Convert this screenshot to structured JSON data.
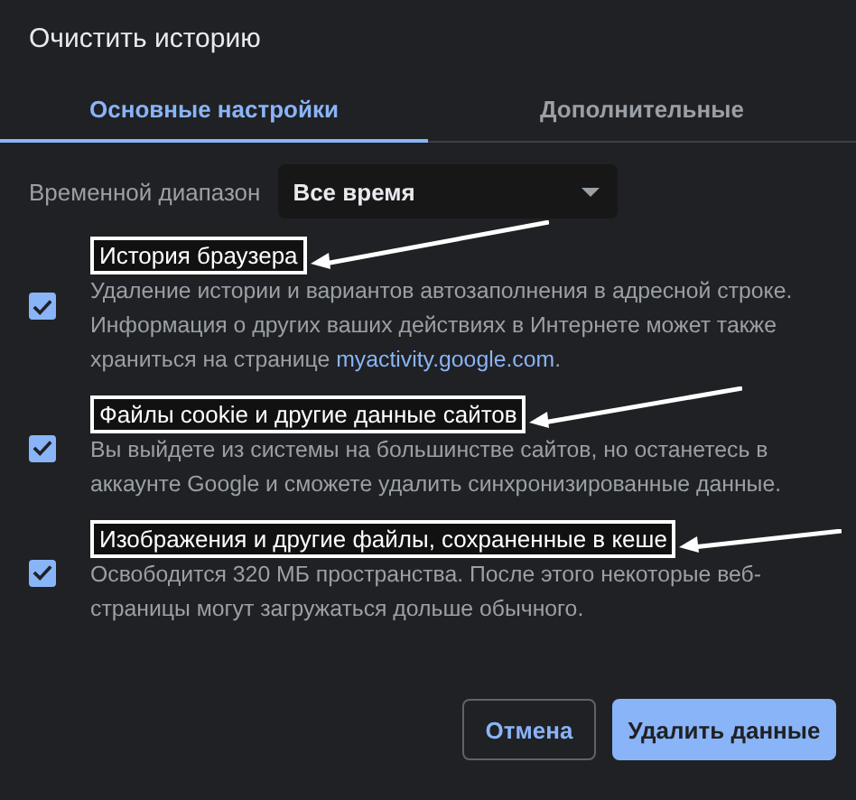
{
  "dialog": {
    "title": "Очистить историю"
  },
  "tabs": [
    {
      "label": "Основные настройки",
      "selected": true
    },
    {
      "label": "Дополнительные",
      "selected": false
    }
  ],
  "time_range": {
    "label": "Временной диапазон",
    "value": "Все время"
  },
  "items": [
    {
      "title": "История браузера",
      "checked": true,
      "annotated": true,
      "description": "Удаление истории и вариантов автозаполнения в адресной строке. Информация о других ваших действиях в Интернете может также храниться на странице ",
      "link": "myactivity.google.com",
      "description_end": "."
    },
    {
      "title": "Файлы cookie и другие данные сайтов",
      "checked": true,
      "annotated": true,
      "description": "Вы выйдете из системы на большинстве сайтов, но останетесь в аккаунте Google и сможете удалить синхронизированные данные."
    },
    {
      "title": "Изображения и другие файлы, сохраненные в кеше",
      "checked": true,
      "annotated": true,
      "description": "Освободится 320 МБ пространства. После этого некоторые веб-страницы могут загружаться дольше обычного."
    }
  ],
  "buttons": {
    "cancel": "Отмена",
    "confirm": "Удалить данные"
  }
}
